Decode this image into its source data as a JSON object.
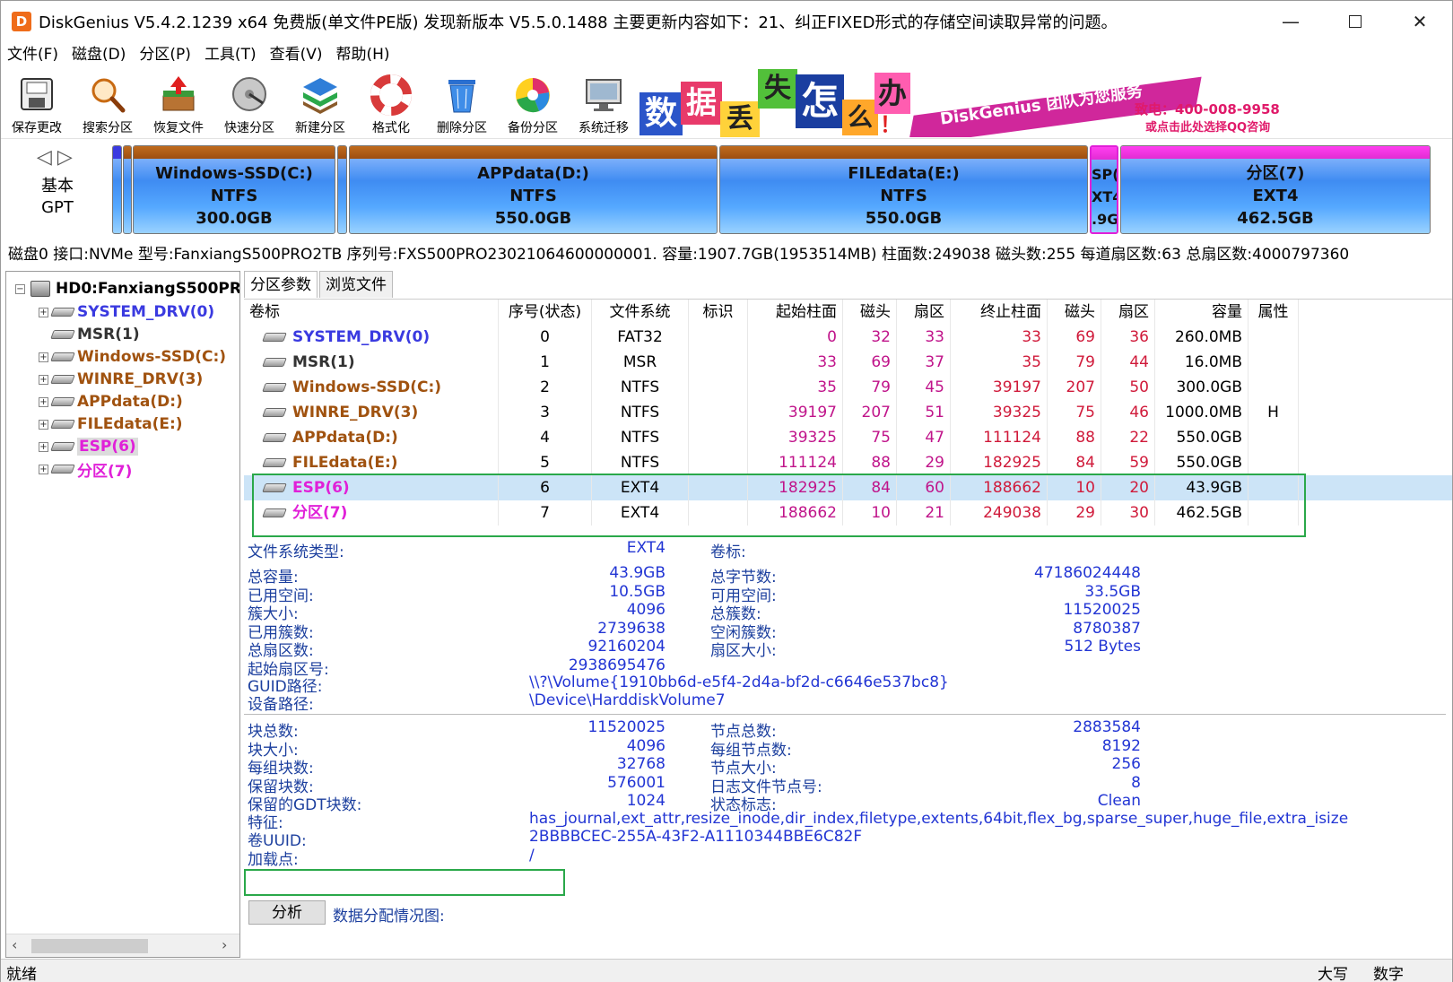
{
  "title": "DiskGenius V5.4.2.1239 x64 免费版(单文件PE版)   发现新版本 V5.5.0.1488   主要更新内容如下：21、纠正FIXED形式的存储空间读取异常的问题。",
  "menu": [
    "文件(F)",
    "磁盘(D)",
    "分区(P)",
    "工具(T)",
    "查看(V)",
    "帮助(H)"
  ],
  "toolbar": [
    {
      "label": "保存更改",
      "icon": "save-icon"
    },
    {
      "label": "搜索分区",
      "icon": "magnifier-icon"
    },
    {
      "label": "恢复文件",
      "icon": "recover-box-icon"
    },
    {
      "label": "快速分区",
      "icon": "disk-platter-icon"
    },
    {
      "label": "新建分区",
      "icon": "layers-icon"
    },
    {
      "label": "格式化",
      "icon": "lifebuoy-icon"
    },
    {
      "label": "删除分区",
      "icon": "trash-icon"
    },
    {
      "label": "备份分区",
      "icon": "pie-icon"
    },
    {
      "label": "系统迁移",
      "icon": "monitor-icon"
    }
  ],
  "banner": {
    "chars": [
      "数",
      "据",
      "丢",
      "失",
      "怎",
      "么",
      "办",
      "！"
    ],
    "slogan": "DiskGenius 团队为您服务",
    "phone": "致电：400-008-9958",
    "qq": "或点击此处选择QQ咨询"
  },
  "diskmap": {
    "kind": [
      "基本",
      "GPT"
    ],
    "partitions": [
      {
        "name": "Windows-SSD(C:)",
        "fs": "NTFS",
        "size": "300.0GB"
      },
      {
        "name": "APPdata(D:)",
        "fs": "NTFS",
        "size": "550.0GB"
      },
      {
        "name": "FILEdata(E:)",
        "fs": "NTFS",
        "size": "550.0GB"
      },
      {
        "name": "SP(",
        "fs": "XT4",
        "size": ".9G"
      },
      {
        "name": "分区(7)",
        "fs": "EXT4",
        "size": "462.5GB"
      }
    ]
  },
  "disk_info": "磁盘0 接口:NVMe  型号:FanxiangS500PRO2TB  序列号:FXS500PRO23021064600000001.  容量:1907.7GB(1953514MB)  柱面数:249038  磁头数:255  每道扇区数:63  总扇区数:4000797360",
  "tree": {
    "root": "HD0:FanxiangS500PR(",
    "items": [
      {
        "label": "SYSTEM_DRV(0)",
        "color": "#3a3ae0"
      },
      {
        "label": "MSR(1)",
        "color": "#333333"
      },
      {
        "label": "Windows-SSD(C:)",
        "color": "#a0520f"
      },
      {
        "label": "WINRE_DRV(3)",
        "color": "#a0520f"
      },
      {
        "label": "APPdata(D:)",
        "color": "#a0520f"
      },
      {
        "label": "FILEdata(E:)",
        "color": "#a0520f"
      },
      {
        "label": "ESP(6)",
        "color": "#e020d8"
      },
      {
        "label": "分区(7)",
        "color": "#e020d8"
      }
    ]
  },
  "tabs": [
    "分区参数",
    "浏览文件"
  ],
  "grid": {
    "headers": [
      "卷标",
      "序号(状态)",
      "文件系统",
      "标识",
      "起始柱面",
      "磁头",
      "扇区",
      "终止柱面",
      "磁头",
      "扇区",
      "容量",
      "属性"
    ],
    "rows": [
      {
        "label": "SYSTEM_DRV(0)",
        "color": "#3a3ae0",
        "seq": "0",
        "fs": "FAT32",
        "flag": "",
        "sc": "0",
        "sh": "32",
        "ss": "33",
        "ec": "33",
        "eh": "69",
        "es": "36",
        "size": "260.0MB",
        "attr": ""
      },
      {
        "label": "MSR(1)",
        "color": "#333333",
        "seq": "1",
        "fs": "MSR",
        "flag": "",
        "sc": "33",
        "sh": "69",
        "ss": "37",
        "ec": "35",
        "eh": "79",
        "es": "44",
        "size": "16.0MB",
        "attr": ""
      },
      {
        "label": "Windows-SSD(C:)",
        "color": "#a0520f",
        "seq": "2",
        "fs": "NTFS",
        "flag": "",
        "sc": "35",
        "sh": "79",
        "ss": "45",
        "ec": "39197",
        "eh": "207",
        "es": "50",
        "size": "300.0GB",
        "attr": ""
      },
      {
        "label": "WINRE_DRV(3)",
        "color": "#a0520f",
        "seq": "3",
        "fs": "NTFS",
        "flag": "",
        "sc": "39197",
        "sh": "207",
        "ss": "51",
        "ec": "39325",
        "eh": "75",
        "es": "46",
        "size": "1000.0MB",
        "attr": "H"
      },
      {
        "label": "APPdata(D:)",
        "color": "#a0520f",
        "seq": "4",
        "fs": "NTFS",
        "flag": "",
        "sc": "39325",
        "sh": "75",
        "ss": "47",
        "ec": "111124",
        "eh": "88",
        "es": "22",
        "size": "550.0GB",
        "attr": ""
      },
      {
        "label": "FILEdata(E:)",
        "color": "#a0520f",
        "seq": "5",
        "fs": "NTFS",
        "flag": "",
        "sc": "111124",
        "sh": "88",
        "ss": "29",
        "ec": "182925",
        "eh": "84",
        "es": "59",
        "size": "550.0GB",
        "attr": ""
      },
      {
        "label": "ESP(6)",
        "color": "#e020d8",
        "seq": "6",
        "fs": "EXT4",
        "flag": "",
        "sc": "182925",
        "sh": "84",
        "ss": "60",
        "ec": "188662",
        "eh": "10",
        "es": "20",
        "size": "43.9GB",
        "attr": "",
        "selected": true
      },
      {
        "label": "分区(7)",
        "color": "#e020d8",
        "seq": "7",
        "fs": "EXT4",
        "flag": "",
        "sc": "188662",
        "sh": "10",
        "ss": "21",
        "ec": "249038",
        "eh": "29",
        "es": "30",
        "size": "462.5GB",
        "attr": ""
      }
    ]
  },
  "details": {
    "fs_type_label": "文件系统类型:",
    "fs_type": "EXT4",
    "vol_label": "卷标:",
    "left": [
      {
        "k": "总容量:",
        "v": "43.9GB"
      },
      {
        "k": "已用空间:",
        "v": "10.5GB"
      },
      {
        "k": "簇大小:",
        "v": "4096"
      },
      {
        "k": "已用簇数:",
        "v": "2739638"
      },
      {
        "k": "总扇区数:",
        "v": "92160204"
      },
      {
        "k": "起始扇区号:",
        "v": "2938695476"
      }
    ],
    "right": [
      {
        "k": "总字节数:",
        "v": "47186024448"
      },
      {
        "k": "可用空间:",
        "v": "33.5GB"
      },
      {
        "k": "总簇数:",
        "v": "11520025"
      },
      {
        "k": "空闲簇数:",
        "v": "8780387"
      },
      {
        "k": "扇区大小:",
        "v": "512 Bytes"
      }
    ],
    "guid_label": "GUID路径:",
    "guid": "\\\\?\\Volume{1910bb6d-e5f4-2d4a-bf2d-c6646e537bc8}",
    "device_label": "设备路径:",
    "device": "\\Device\\HarddiskVolume7",
    "left2": [
      {
        "k": "块总数:",
        "v": "11520025"
      },
      {
        "k": "块大小:",
        "v": "4096"
      },
      {
        "k": "每组块数:",
        "v": "32768"
      },
      {
        "k": "保留块数:",
        "v": "576001"
      },
      {
        "k": "保留的GDT块数:",
        "v": "1024"
      }
    ],
    "right2": [
      {
        "k": "节点总数:",
        "v": "2883584"
      },
      {
        "k": "每组节点数:",
        "v": "8192"
      },
      {
        "k": "节点大小:",
        "v": "256"
      },
      {
        "k": "日志文件节点号:",
        "v": "8"
      },
      {
        "k": "状态标志:",
        "v": "Clean"
      }
    ],
    "features_label": "特征:",
    "features": "has_journal,ext_attr,resize_inode,dir_index,filetype,extents,64bit,flex_bg,sparse_super,huge_file,extra_isize",
    "uuid_label": "卷UUID:",
    "uuid": "2BBBBCEC-255A-43F2-A1110344BBE6C82F",
    "mount_label": "加载点:",
    "mount": "/"
  },
  "analyze_button": "分析",
  "alloc_label": "数据分配情况图:",
  "status": {
    "left": "就绪",
    "caps": "大写",
    "num": "数字"
  },
  "colors": {
    "accent_green": "#2aa84a",
    "selection": "#cce4f7",
    "number": "#c0148a"
  }
}
